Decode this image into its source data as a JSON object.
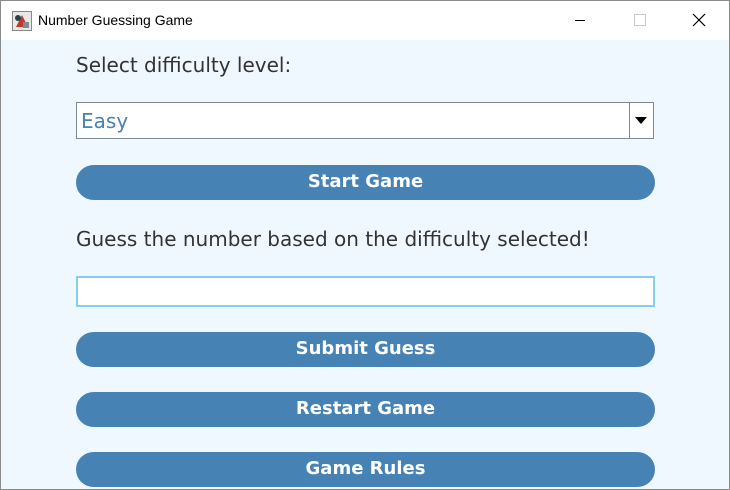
{
  "window": {
    "title": "Number Guessing Game"
  },
  "controls": {
    "minimize_icon": "minimize-icon",
    "maximize_icon": "maximize-icon",
    "close_icon": "close-icon"
  },
  "difficulty": {
    "label": "Select difficulty level:",
    "selected": "Easy"
  },
  "start_button": "Start Game",
  "guess": {
    "prompt": "Guess the number based on the difficulty selected!",
    "value": ""
  },
  "buttons": {
    "submit": "Submit Guess",
    "restart": "Restart Game",
    "rules": "Game Rules"
  },
  "colors": {
    "background": "#F0F8FF",
    "button": "#4682B4",
    "input_border": "#87CEEB",
    "label_text": "#333333"
  }
}
